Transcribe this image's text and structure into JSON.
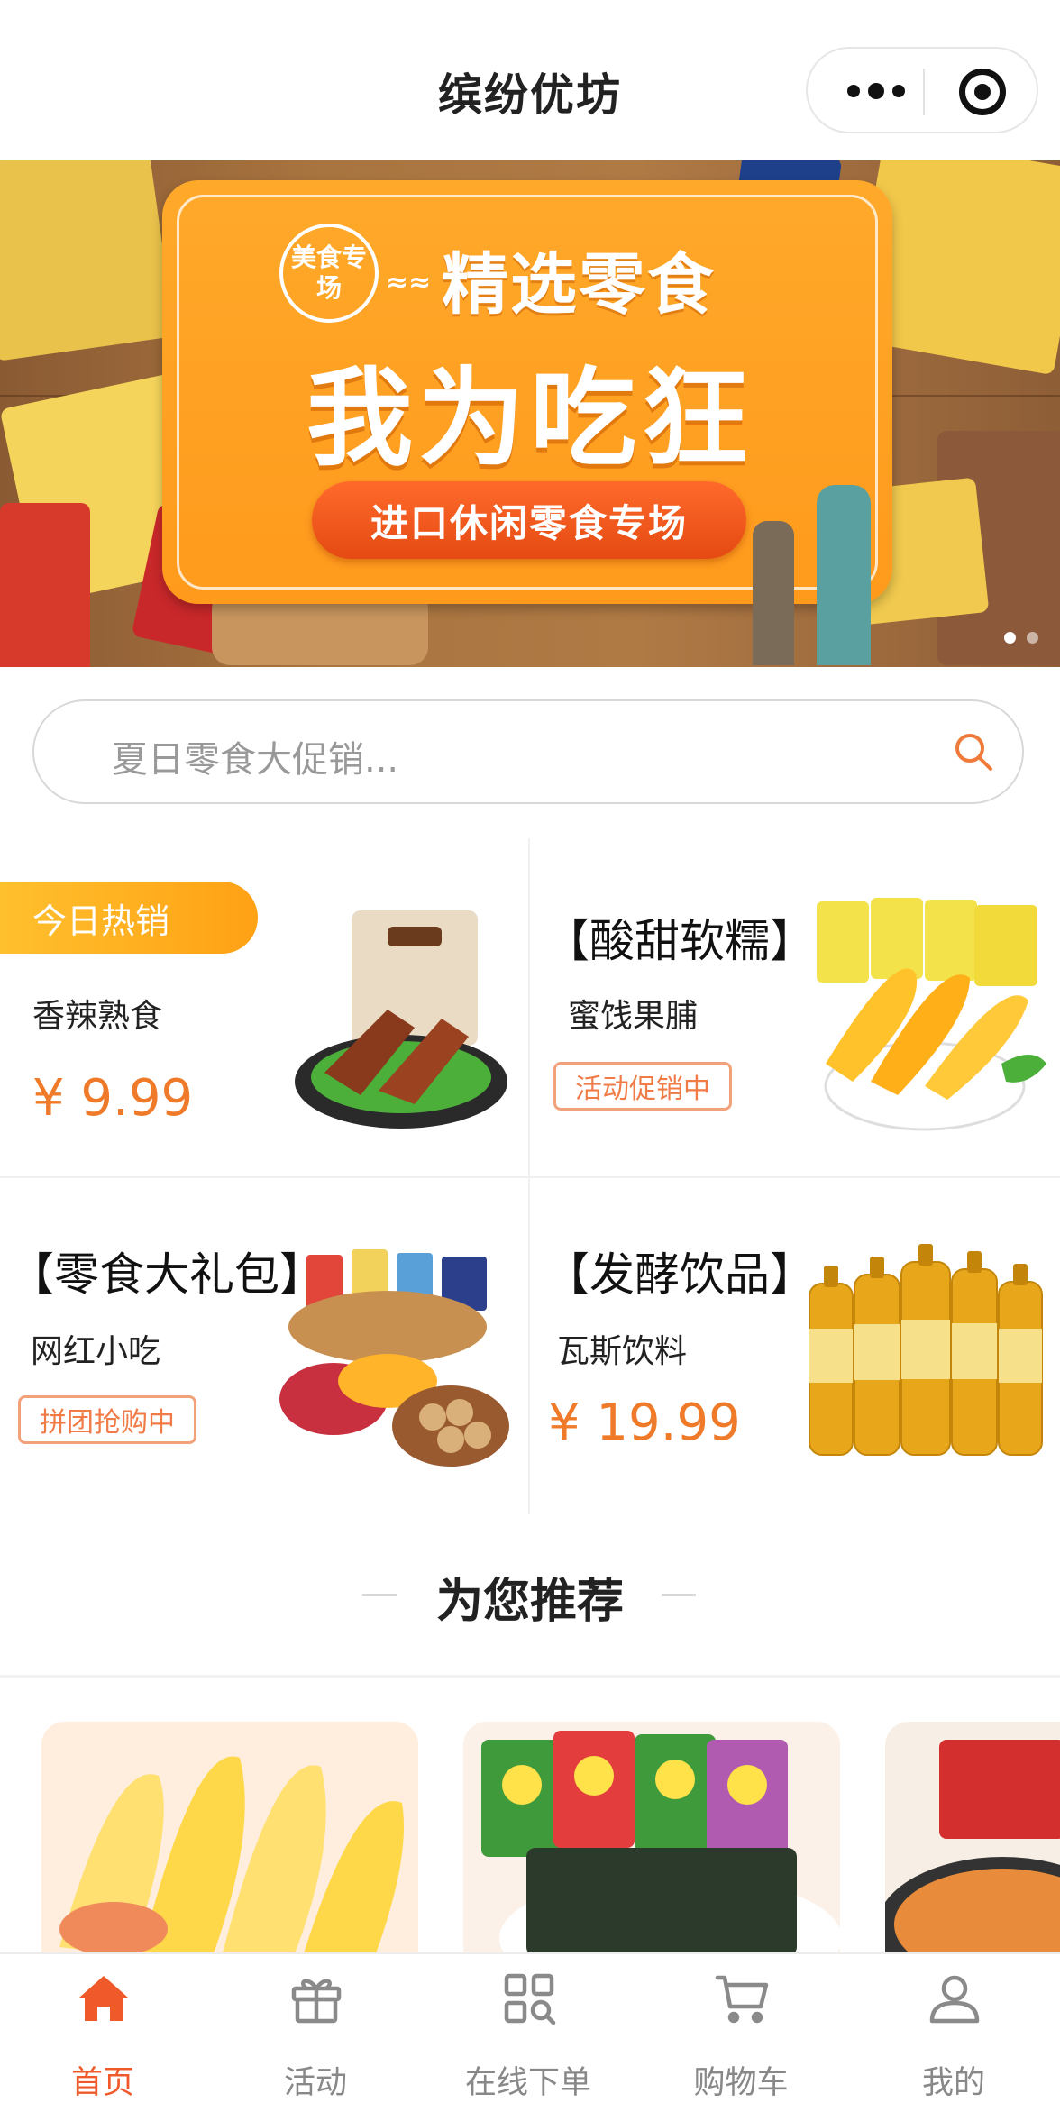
{
  "navbar": {
    "title": "缤纷优坊"
  },
  "banner": {
    "badge": "美食专场",
    "subtitle": "精选零食",
    "headline": "我为吃狂",
    "pill": "进口休闲零食专场",
    "active_dot": 1,
    "dot_count": 2
  },
  "search": {
    "placeholder": "夏日零食大促销..."
  },
  "products": [
    {
      "tag": "今日热销",
      "title": "",
      "subtitle": "香辣熟食",
      "price": "¥ 9.99",
      "chip": ""
    },
    {
      "tag": "",
      "title": "【酸甜软糯】",
      "subtitle": "蜜饯果脯",
      "price": "",
      "chip": "活动促销中"
    },
    {
      "tag": "",
      "title": "【零食大礼包】",
      "subtitle": "网红小吃",
      "price": "",
      "chip": "拼团抢购中"
    },
    {
      "tag": "",
      "title": "【发酵饮品】",
      "subtitle": "瓦斯饮料",
      "price": "¥ 19.99",
      "chip": ""
    }
  ],
  "recommend": {
    "title": "为您推荐"
  },
  "tabbar": {
    "items": [
      {
        "label": "首页",
        "icon": "home-icon",
        "active": true
      },
      {
        "label": "活动",
        "icon": "gift-icon",
        "active": false
      },
      {
        "label": "在线下单",
        "icon": "grid-search-icon",
        "active": false
      },
      {
        "label": "购物车",
        "icon": "cart-icon",
        "active": false
      },
      {
        "label": "我的",
        "icon": "user-icon",
        "active": false
      }
    ]
  },
  "colors": {
    "accent": "#f05a2a",
    "price": "#ef7b2a",
    "tag": "#ffa114"
  }
}
